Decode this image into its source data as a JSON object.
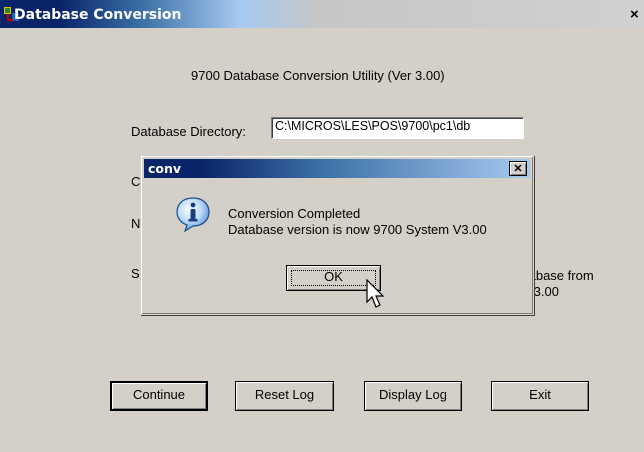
{
  "window": {
    "title": "Database Conversion",
    "close_glyph": "×"
  },
  "main": {
    "heading": "9700 Database Conversion Utility (Ver 3.00)",
    "db_dir_label": "Database Directory:",
    "db_dir_value": "C:\\MICROS\\LES\\POS\\9700\\pc1\\db",
    "hidden_label_c": "C",
    "hidden_label_n": "N",
    "hidden_label_s": "S",
    "status_line1": "tabase from",
    "status_line2": "V3.00"
  },
  "buttons": {
    "continue": "Continue",
    "reset_log": "Reset Log",
    "display_log": "Display Log",
    "exit": "Exit"
  },
  "dialog": {
    "title": "conv",
    "close_glyph": "✕",
    "icon": "information-icon",
    "message_line1": "Conversion Completed",
    "message_line2": "Database version is now 9700 System V3.00",
    "ok_label": "OK"
  }
}
